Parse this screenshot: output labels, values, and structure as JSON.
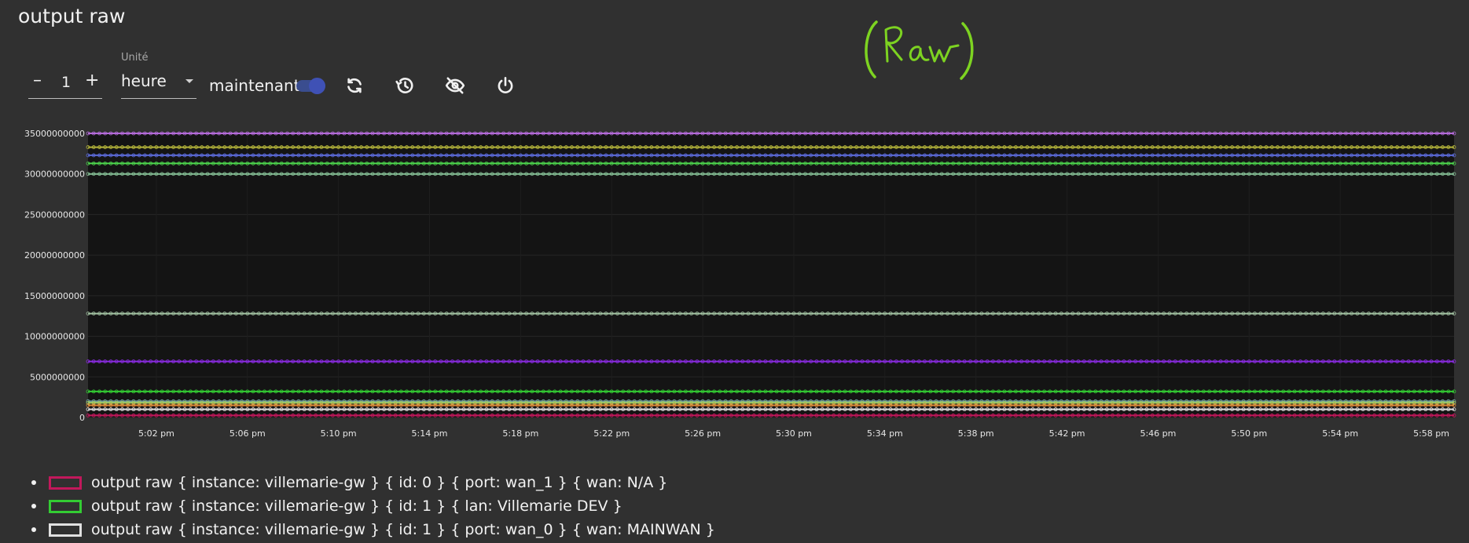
{
  "panel": {
    "title": "output raw"
  },
  "annotation": {
    "text": "(Raw)",
    "color": "#7dd321"
  },
  "controls": {
    "stepper": {
      "minus": "–",
      "value": "1",
      "plus": "+"
    },
    "unit": {
      "label": "Unité",
      "value": "heure"
    },
    "now": {
      "label": "maintenant",
      "enabled": true
    },
    "icons": [
      "refresh-icon",
      "history-icon",
      "visibility-off-icon",
      "power-icon"
    ]
  },
  "chart_data": {
    "type": "line",
    "title": "",
    "xlabel": "",
    "ylabel": "",
    "ylim": [
      0,
      35000000000
    ],
    "y_ticks": [
      "0",
      "5000000000",
      "10000000000",
      "15000000000",
      "20000000000",
      "25000000000",
      "30000000000",
      "35000000000"
    ],
    "x_ticks": [
      "5:02 pm",
      "5:06 pm",
      "5:10 pm",
      "5:14 pm",
      "5:18 pm",
      "5:22 pm",
      "5:26 pm",
      "5:30 pm",
      "5:34 pm",
      "5:38 pm",
      "5:42 pm",
      "5:46 pm",
      "5:50 pm",
      "5:54 pm",
      "5:58 pm"
    ],
    "x_range": [
      "4:59 pm",
      "5:59 pm"
    ],
    "grid": true,
    "series": [
      {
        "name": "output raw { instance: villemarie-gw } { id: 0 } { port: wan_1 } { wan: N/A }",
        "color": "#c2185b",
        "values": [
          250000000
        ]
      },
      {
        "name": "output raw { instance: villemarie-gw } { id: 1 } { lan: Villemarie DEV }",
        "color": "#33cc33",
        "values": [
          3200000000
        ]
      },
      {
        "name": "output raw { instance: villemarie-gw } { id: 1 } { port: wan_0 } { wan: MAINWAN }",
        "color": "#e0e0e0",
        "values": [
          1000000000
        ]
      },
      {
        "color": "#b36ad8",
        "values": [
          35000000000
        ]
      },
      {
        "color": "#b5b53a",
        "values": [
          33300000000
        ]
      },
      {
        "color": "#5b6ad8",
        "values": [
          32300000000
        ]
      },
      {
        "color": "#4cd24c",
        "values": [
          31300000000
        ]
      },
      {
        "color": "#86c096",
        "values": [
          30000000000
        ]
      },
      {
        "color": "#a2c2a2",
        "values": [
          12800000000
        ]
      },
      {
        "color": "#8a2be2",
        "values": [
          6900000000
        ]
      },
      {
        "color": "#6fa0a0",
        "values": [
          2000000000
        ]
      },
      {
        "color": "#a8d060",
        "values": [
          1800000000
        ]
      },
      {
        "color": "#e08a3a",
        "values": [
          1500000000
        ]
      }
    ]
  },
  "legend": [
    {
      "label": "output raw { instance: villemarie-gw } { id: 0 } { port: wan_1 } { wan: N/A }",
      "color": "#c2185b"
    },
    {
      "label": "output raw { instance: villemarie-gw } { id: 1 } { lan: Villemarie DEV }",
      "color": "#33cc33"
    },
    {
      "label": "output raw { instance: villemarie-gw } { id: 1 } { port: wan_0 } { wan: MAINWAN }",
      "color": "#e0e0e0"
    }
  ]
}
